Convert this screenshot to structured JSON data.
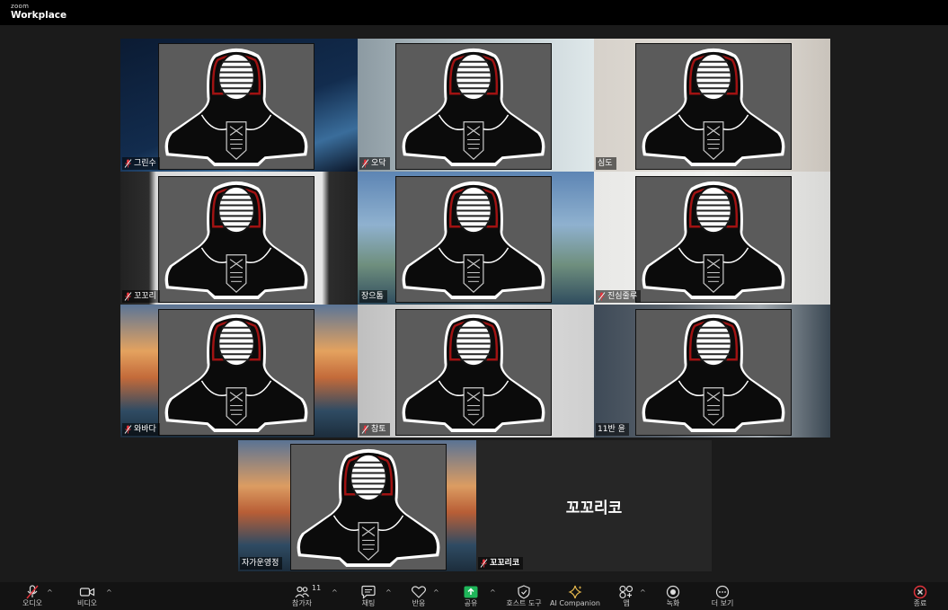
{
  "app": {
    "brand_small": "zoom",
    "brand_big": "Workplace"
  },
  "participants": [
    {
      "name": "그린수",
      "muted": true,
      "active": false
    },
    {
      "name": "오닥",
      "muted": true,
      "active": false
    },
    {
      "name": "심도",
      "muted": false,
      "active": true
    },
    {
      "name": "꼬꼬리",
      "muted": true,
      "active": false
    },
    {
      "name": "장으톰",
      "muted": false,
      "active": false
    },
    {
      "name": "진심줄루",
      "muted": true,
      "active": false
    },
    {
      "name": "와바다",
      "muted": true,
      "active": false
    },
    {
      "name": "참토",
      "muted": true,
      "active": false
    },
    {
      "name": "11반 윤",
      "muted": false,
      "active": false
    },
    {
      "name": "자가운영정",
      "muted": false,
      "active": false
    },
    {
      "name": "꼬꼬리코",
      "muted": true,
      "active": false
    }
  ],
  "big_name": "꼬꼬리코",
  "toolbar": {
    "audio": "오디오",
    "video": "비디오",
    "participants": "참가자",
    "participants_count": "11",
    "chat": "채팅",
    "reactions": "반응",
    "share": "공유",
    "host_tools": "호스트 도구",
    "ai_companion": "AI Companion",
    "apps": "앱",
    "record": "녹화",
    "more": "더 보기",
    "end": "종료"
  },
  "colors": {
    "active_outline": "#2bd25c",
    "share_green": "#1fb65a",
    "end_red": "#e0333b",
    "camera_gray": "#5b5b5b"
  }
}
